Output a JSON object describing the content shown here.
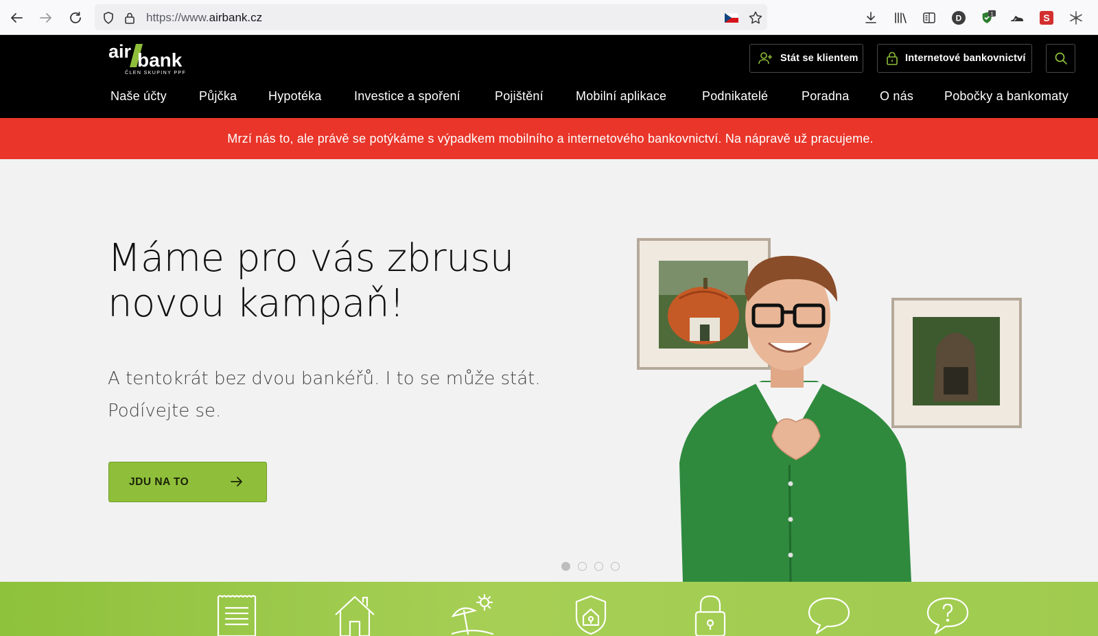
{
  "browser": {
    "url_prefix": "https://www.",
    "url_domain": "airbank.cz",
    "badge_count": "1"
  },
  "header": {
    "logo_air": "air",
    "logo_bank": "bank",
    "logo_sub": "ČLEN SKUPINY PPF",
    "become_client": "Stát se klientem",
    "internet_banking": "Internetové bankovnictví",
    "nav": [
      "Naše účty",
      "Půjčka",
      "Hypotéka",
      "Investice a spoření",
      "Pojištění",
      "Mobilní aplikace",
      "Podnikatelé",
      "Poradna",
      "O nás",
      "Pobočky a bankomaty"
    ]
  },
  "alert": {
    "message": "Mrzí nás to, ale právě se potýkáme s výpadkem mobilního a internetového bankovnictví. Na nápravě už pracujeme."
  },
  "hero": {
    "title_line1": "Máme pro vás zbrusu",
    "title_line2": "novou kampaň!",
    "subtitle_line1": "A tentokrát bez dvou bankéřů. I to se může stát.",
    "subtitle_line2": "Podívejte se.",
    "cta": "JDU NA TO"
  },
  "carousel": {
    "count": 4,
    "active": 0
  },
  "colors": {
    "brand_green": "#8fbf3a",
    "alert_red": "#e9352a",
    "header_black": "#000000"
  }
}
